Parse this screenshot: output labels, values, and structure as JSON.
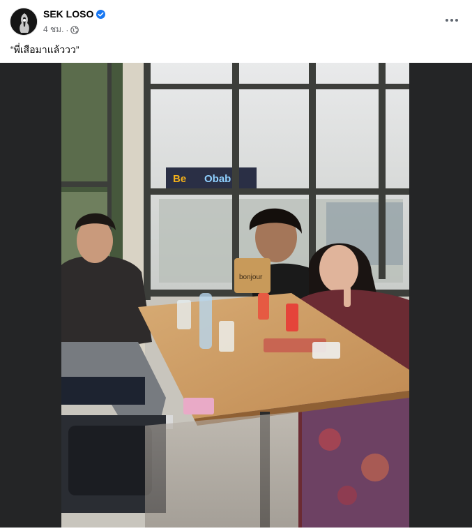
{
  "post": {
    "author": "SEK LOSO",
    "verified": true,
    "time": "4 ชม.",
    "separator": "·",
    "audience_icon": "globe-icon",
    "more_icon": "more-options-icon",
    "caption": "“พี่เสือมาแล้ววว”"
  },
  "photo": {
    "bag_text": "bonjour",
    "sign_text_1": "Be",
    "sign_text_2": "Obab"
  },
  "colors": {
    "media_background": "#242526",
    "verified_blue": "#1877f2",
    "meta_gray": "#65676b"
  }
}
